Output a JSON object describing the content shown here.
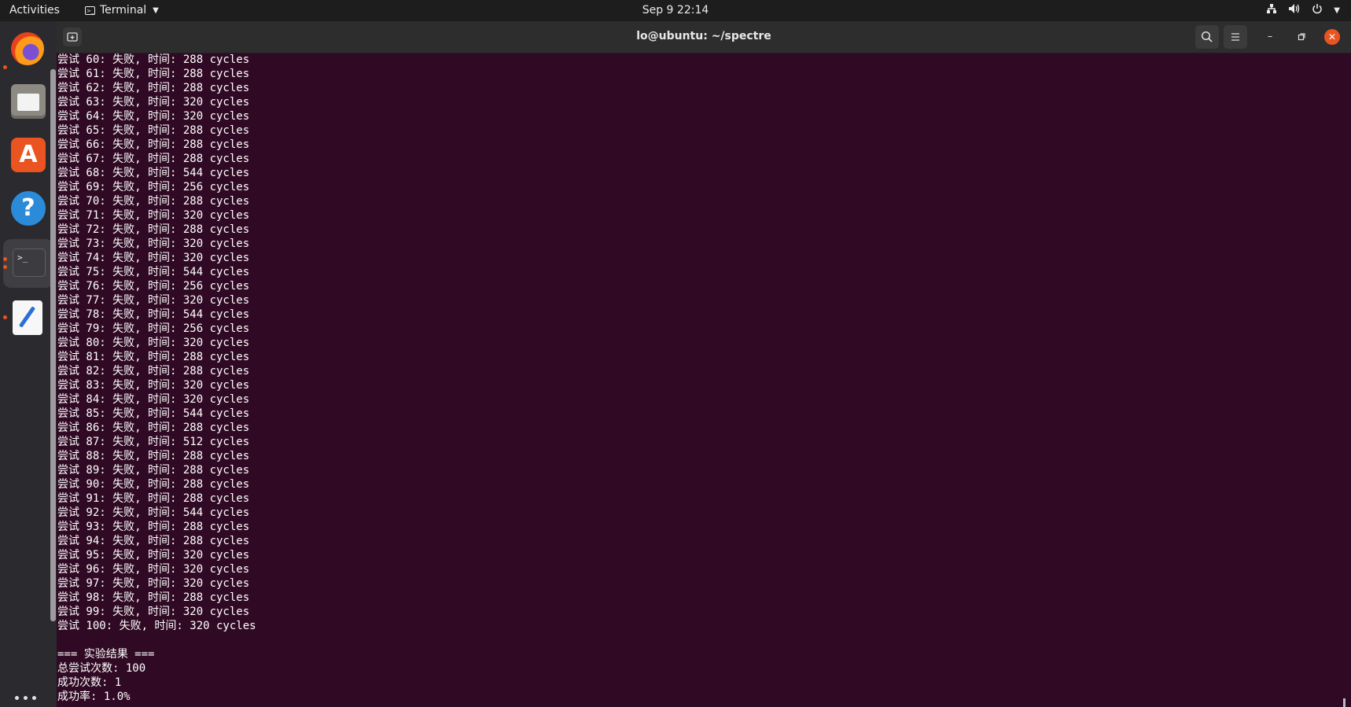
{
  "topbar": {
    "activities": "Activities",
    "app_name": "Terminal",
    "clock": "Sep 9  22:14"
  },
  "window": {
    "title": "lo@ubuntu: ~/spectre"
  },
  "terminal_lines": [
    "尝试 60: 失败, 时间: 288 cycles",
    "尝试 61: 失败, 时间: 288 cycles",
    "尝试 62: 失败, 时间: 288 cycles",
    "尝试 63: 失败, 时间: 320 cycles",
    "尝试 64: 失败, 时间: 320 cycles",
    "尝试 65: 失败, 时间: 288 cycles",
    "尝试 66: 失败, 时间: 288 cycles",
    "尝试 67: 失败, 时间: 288 cycles",
    "尝试 68: 失败, 时间: 544 cycles",
    "尝试 69: 失败, 时间: 256 cycles",
    "尝试 70: 失败, 时间: 288 cycles",
    "尝试 71: 失败, 时间: 320 cycles",
    "尝试 72: 失败, 时间: 288 cycles",
    "尝试 73: 失败, 时间: 320 cycles",
    "尝试 74: 失败, 时间: 320 cycles",
    "尝试 75: 失败, 时间: 544 cycles",
    "尝试 76: 失败, 时间: 256 cycles",
    "尝试 77: 失败, 时间: 320 cycles",
    "尝试 78: 失败, 时间: 544 cycles",
    "尝试 79: 失败, 时间: 256 cycles",
    "尝试 80: 失败, 时间: 320 cycles",
    "尝试 81: 失败, 时间: 288 cycles",
    "尝试 82: 失败, 时间: 288 cycles",
    "尝试 83: 失败, 时间: 320 cycles",
    "尝试 84: 失败, 时间: 320 cycles",
    "尝试 85: 失败, 时间: 544 cycles",
    "尝试 86: 失败, 时间: 288 cycles",
    "尝试 87: 失败, 时间: 512 cycles",
    "尝试 88: 失败, 时间: 288 cycles",
    "尝试 89: 失败, 时间: 288 cycles",
    "尝试 90: 失败, 时间: 288 cycles",
    "尝试 91: 失败, 时间: 288 cycles",
    "尝试 92: 失败, 时间: 544 cycles",
    "尝试 93: 失败, 时间: 288 cycles",
    "尝试 94: 失败, 时间: 288 cycles",
    "尝试 95: 失败, 时间: 320 cycles",
    "尝试 96: 失败, 时间: 320 cycles",
    "尝试 97: 失败, 时间: 320 cycles",
    "尝试 98: 失败, 时间: 288 cycles",
    "尝试 99: 失败, 时间: 320 cycles",
    "尝试 100: 失败, 时间: 320 cycles",
    "",
    "=== 实验结果 ===",
    "总尝试次数: 100",
    "成功次数: 1",
    "成功率: 1.0%"
  ],
  "colors": {
    "terminal_bg": "#300a24",
    "accent": "#e95420"
  },
  "icons": {
    "dock": [
      "firefox-icon",
      "files-icon",
      "app-store-icon",
      "help-icon",
      "terminal-icon",
      "text-editor-icon",
      "show-apps-icon"
    ],
    "tray": [
      "network-icon",
      "volume-icon",
      "power-icon"
    ]
  }
}
